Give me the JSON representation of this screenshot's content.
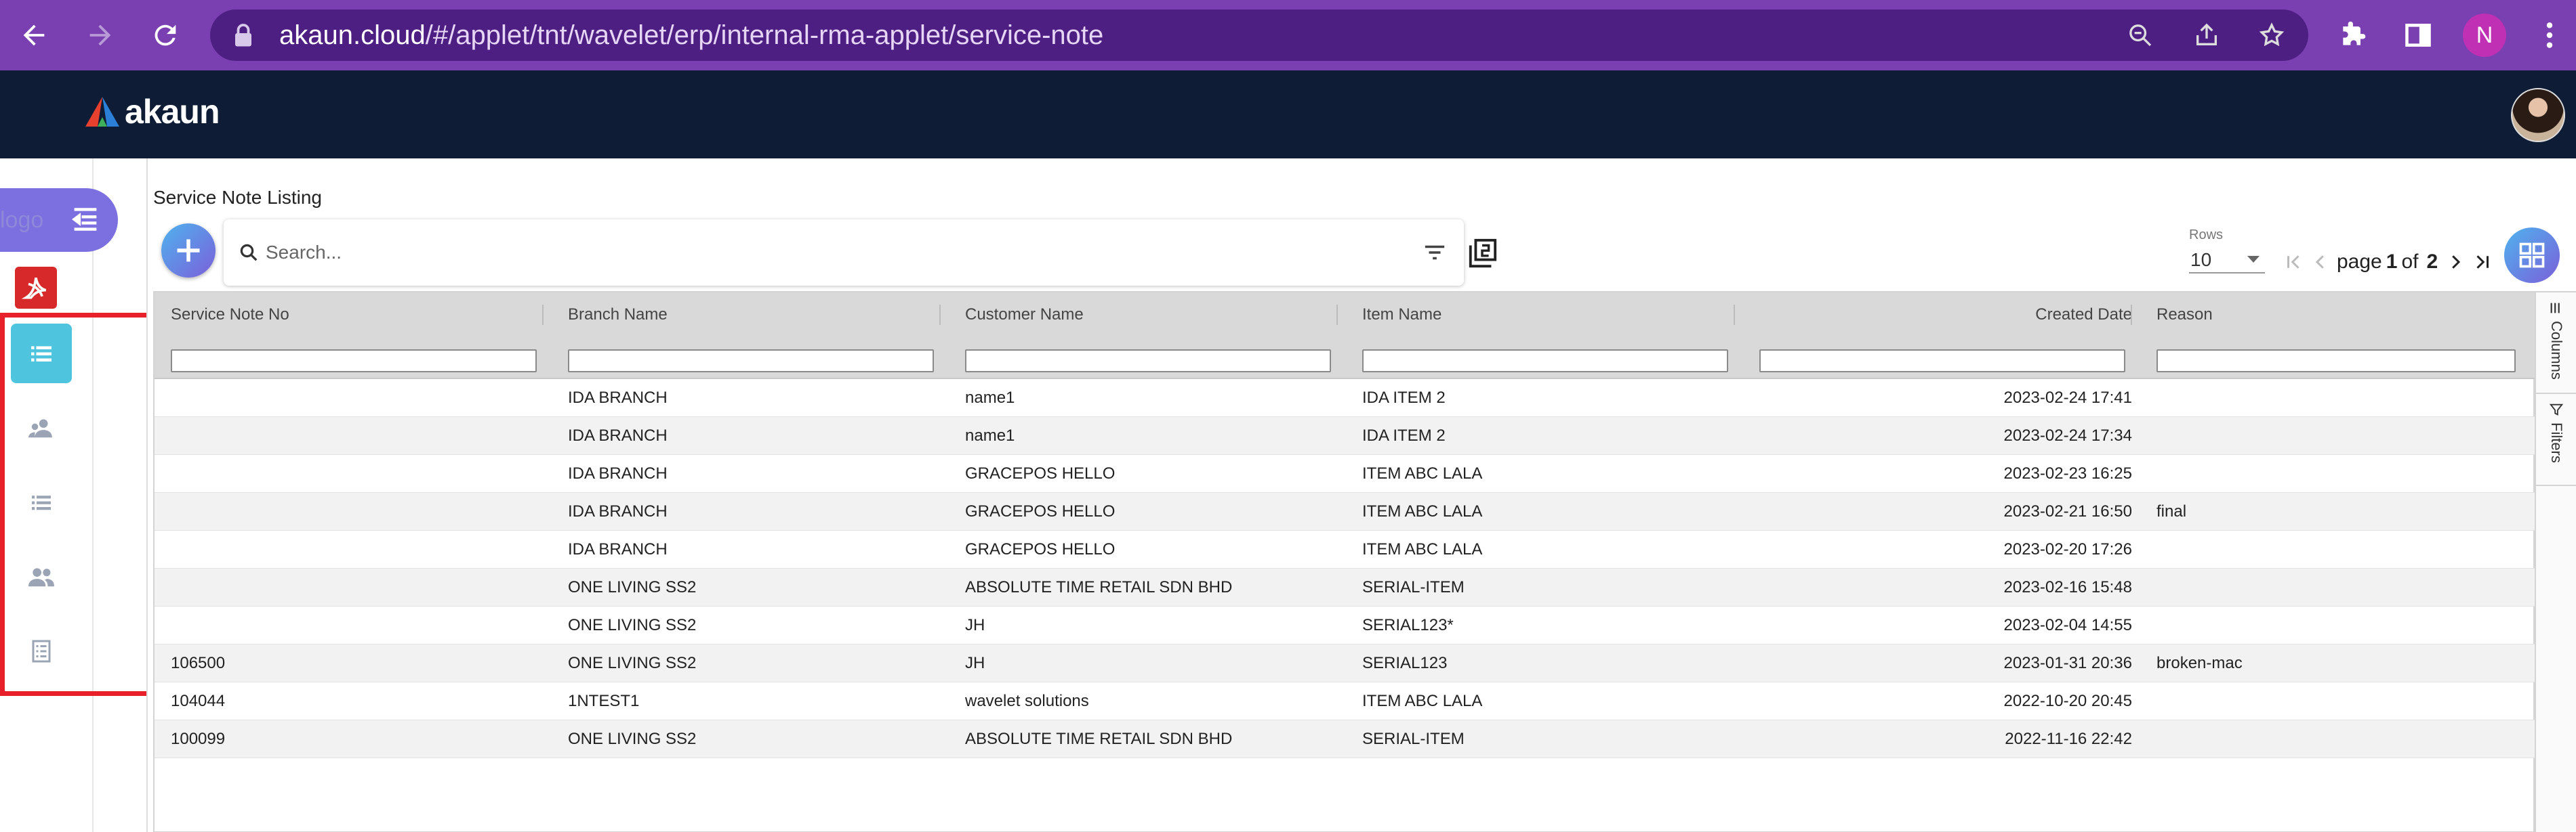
{
  "browser": {
    "url_domain": "akaun.cloud",
    "url_path": "/#/applet/tnt/wavelet/erp/internal-rma-applet/service-note",
    "profile_initial": "N"
  },
  "app": {
    "brand": "akaun"
  },
  "rail": {
    "logo_alt": "logo",
    "items": [
      "list-icon",
      "person-group-icon",
      "list-icon",
      "people-icon",
      "document-list-icon"
    ]
  },
  "page": {
    "title": "Service Note Listing",
    "search_placeholder": "Search...",
    "rows_label": "Rows",
    "rows_value": "10",
    "page_word": "page",
    "page_current": "1",
    "page_of": "of",
    "page_total": "2"
  },
  "table": {
    "columns": [
      "Service Note No",
      "Branch Name",
      "Customer Name",
      "Item Name",
      "Created Date",
      "Reason"
    ],
    "rows": [
      [
        "",
        "IDA BRANCH",
        "name1",
        "IDA ITEM 2",
        "2023-02-24 17:41",
        ""
      ],
      [
        "",
        "IDA BRANCH",
        "name1",
        "IDA ITEM 2",
        "2023-02-24 17:34",
        ""
      ],
      [
        "",
        "IDA BRANCH",
        "GRACEPOS HELLO",
        "ITEM ABC LALA",
        "2023-02-23 16:25",
        ""
      ],
      [
        "",
        "IDA BRANCH",
        "GRACEPOS HELLO",
        "ITEM ABC LALA",
        "2023-02-21 16:50",
        "final"
      ],
      [
        "",
        "IDA BRANCH",
        "GRACEPOS HELLO",
        "ITEM ABC LALA",
        "2023-02-20 17:26",
        ""
      ],
      [
        "",
        "ONE LIVING SS2",
        "ABSOLUTE TIME RETAIL SDN BHD",
        "SERIAL-ITEM",
        "2023-02-16 15:48",
        ""
      ],
      [
        "",
        "ONE LIVING SS2",
        "JH",
        "SERIAL123*",
        "2023-02-04 14:55",
        ""
      ],
      [
        "106500",
        "ONE LIVING SS2",
        "JH",
        "SERIAL123",
        "2023-01-31 20:36",
        "broken-mac"
      ],
      [
        "104044",
        "1NTEST1",
        "wavelet solutions",
        "ITEM ABC LALA",
        "2022-10-20 20:45",
        ""
      ],
      [
        "100099",
        "ONE LIVING SS2",
        "ABSOLUTE TIME RETAIL SDN BHD",
        "SERIAL-ITEM",
        "2022-11-16 22:42",
        ""
      ]
    ]
  },
  "side_panel": {
    "tabs": [
      "Columns",
      "Filters"
    ]
  },
  "colors": {
    "browser_bar": "#7a3fb0",
    "app_header": "#0e1c35",
    "accent": "#4ec4df",
    "highlight": "#e8202a"
  }
}
